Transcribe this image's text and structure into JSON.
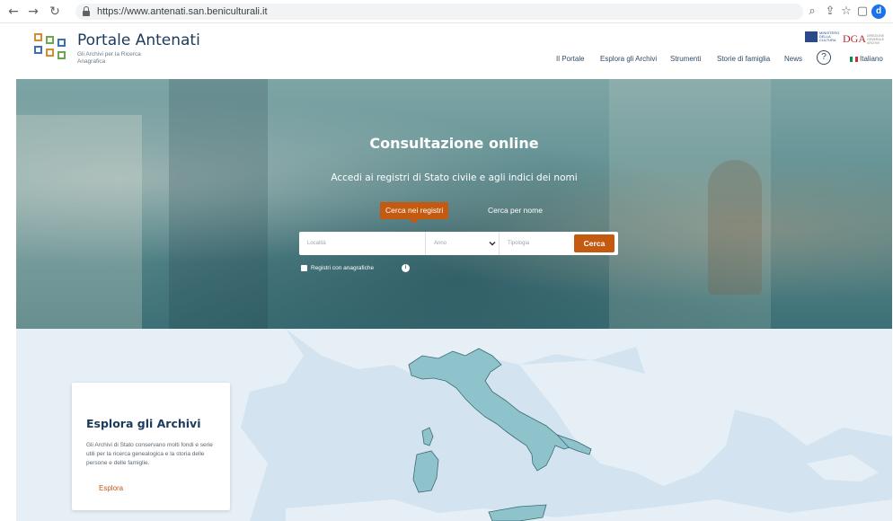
{
  "browser": {
    "url": "https://www.antenati.san.beniculturali.it",
    "profile_initial": "d"
  },
  "header": {
    "logo_title": "Portale Antenati",
    "logo_subtitle": "Gli Archivi per la Ricerca Anagrafica",
    "nav": [
      "Il Portale",
      "Esplora gli Archivi",
      "Strumenti",
      "Storie di famiglia",
      "News"
    ],
    "help": "?",
    "language": "Italiano",
    "partner_mic": "MINISTERO DELLA CULTURA",
    "partner_dga": "DGA",
    "partner_dga_sub": "DIREZIONE GENERALE ARCHIVI"
  },
  "hero": {
    "title": "Consultazione online",
    "subtitle": "Accedi ai registri di Stato civile e agli indici dei nomi",
    "tabs": {
      "active": "Cerca nei registri",
      "inactive": "Cerca per nome"
    },
    "search": {
      "localita_placeholder": "Località",
      "anno_placeholder": "Anno",
      "tipologia_placeholder": "Tipologia",
      "button": "Cerca"
    },
    "checkbox_label": "Registri con anagrafiche",
    "info": "i"
  },
  "card": {
    "title": "Esplora gli Archivi",
    "text": "Gli Archivi di Stato conservano molti fondi e serie utili per la ricerca genealogica e la storia delle persone e delle famiglie.",
    "link": "Esplora"
  },
  "colors": {
    "accent": "#c45a10",
    "brand": "#1b3a5c",
    "italy": "#8fc3cc",
    "sea": "#d3e4f0"
  },
  "icons": {
    "back": "arrow-left-icon",
    "forward": "arrow-right-icon",
    "reload": "reload-icon",
    "lock": "lock-icon",
    "zoom": "search-icon",
    "share": "share-icon",
    "bookmark": "star-icon",
    "sidebar": "sidepanel-icon",
    "help": "question-circle-icon",
    "chevron": "chevron-down-icon"
  }
}
